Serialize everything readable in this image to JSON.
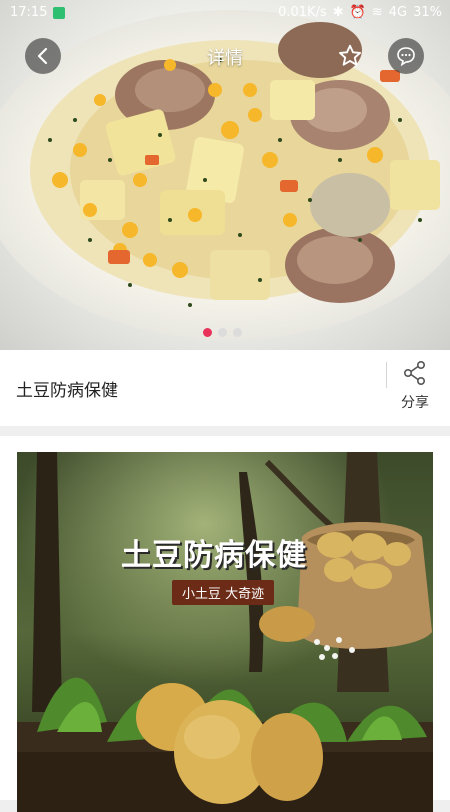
{
  "status_bar": {
    "time": "17:15",
    "network_speed": "0.01K/s",
    "signal": "4G",
    "battery": "31%"
  },
  "header": {
    "title": "详情",
    "back_icon": "chevron-left-icon",
    "favorite_icon": "star-outline-icon",
    "message_icon": "chat-bubble-icon"
  },
  "carousel": {
    "image": "braised-meatballs-with-potato-and-corn",
    "total": 3,
    "active_index": 0
  },
  "recipe": {
    "name": "土豆防病保健"
  },
  "share": {
    "label": "分享",
    "icon": "share-icon"
  },
  "poster": {
    "title": "土豆防病保健",
    "subtitle": "小土豆 大奇迹"
  },
  "colors": {
    "accent_dot": "#e8325a",
    "poster_badge": "#6b2b17"
  }
}
